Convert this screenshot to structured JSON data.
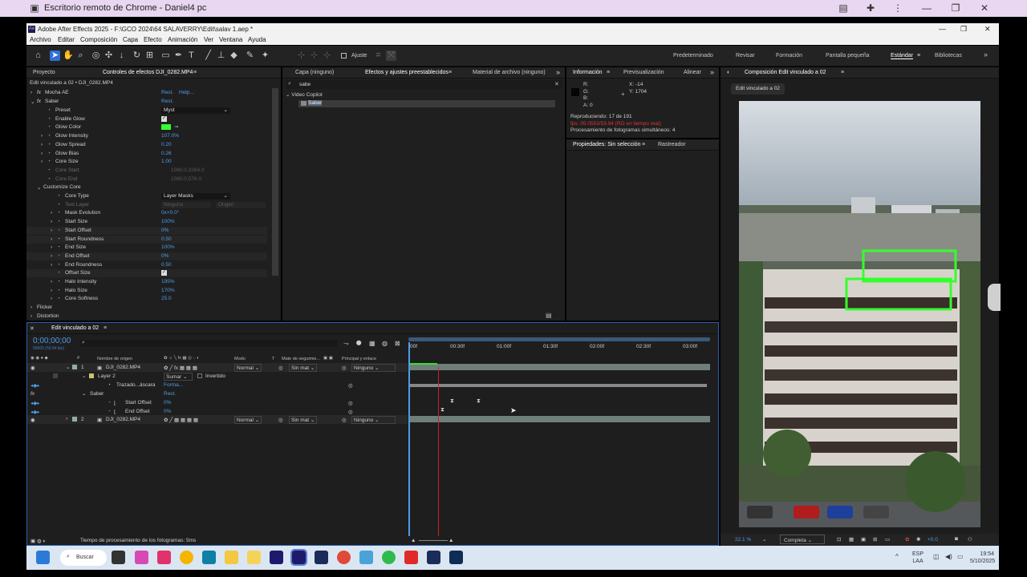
{
  "remote": {
    "title": "Escritorio remoto de Chrome - Daniel4 pc"
  },
  "app": {
    "title": "Adobe After Effects 2025 - F:\\GCO 2024\\64 SALAVERRY\\Edit\\salav 1.aep *",
    "menu": [
      "Archivo",
      "Editar",
      "Composición",
      "Capa",
      "Efecto",
      "Animación",
      "Ver",
      "Ventana",
      "Ayuda"
    ]
  },
  "toolbar": {
    "snap_label": "Ajuste",
    "workspaces": [
      "Predeterminado",
      "Revisar",
      "Formación",
      "Pantalla pequeña",
      "Estándar",
      "Bibliotecas"
    ]
  },
  "project_panel": {
    "tab_project": "Proyecto",
    "tab_effects": "Controles de efectos DJI_0282.MP4"
  },
  "effect_controls": {
    "header": "Edit vinculado a 02 • DJI_0282.MP4",
    "mocha": {
      "label": "Mocha AE",
      "reset": "Rest.",
      "help": "Help..."
    },
    "saber": {
      "label": "Saber",
      "reset": "Rest."
    },
    "props": [
      {
        "name": "Preset",
        "value": "Myst",
        "kind": "dropdown"
      },
      {
        "name": "Enable Glow",
        "value": "",
        "kind": "check"
      },
      {
        "name": "Glow Color",
        "value": "",
        "kind": "color"
      },
      {
        "name": "Glow Intensity",
        "value": "107.0%"
      },
      {
        "name": "Glow Spread",
        "value": "0.20"
      },
      {
        "name": "Glow Bias",
        "value": "0.26"
      },
      {
        "name": "Core Size",
        "value": "1.00"
      },
      {
        "name": "Core Start",
        "value": "1080.0,3264.0",
        "dim": true
      },
      {
        "name": "Core End",
        "value": "1080.0,576.0",
        "dim": true
      },
      {
        "name": "Customize Core",
        "value": "",
        "group": true
      },
      {
        "name": "Core Type",
        "value": "Layer Masks",
        "kind": "dropdown"
      },
      {
        "name": "Text Layer",
        "value": "Ninguno",
        "value2": "Origen",
        "dim": true,
        "kind": "dropdown2"
      },
      {
        "name": "Mask Evolution",
        "value": "0x+0.0°"
      },
      {
        "name": "Start Size",
        "value": "100%"
      },
      {
        "name": "Start Offset",
        "value": "0%"
      },
      {
        "name": "Start Roundness",
        "value": "0.50"
      },
      {
        "name": "End Size",
        "value": "100%"
      },
      {
        "name": "End Offset",
        "value": "0%"
      },
      {
        "name": "End Roundness",
        "value": "0.50"
      },
      {
        "name": "Offset Size",
        "value": "",
        "kind": "check"
      },
      {
        "name": "Halo Intensity",
        "value": "195%"
      },
      {
        "name": "Halo Size",
        "value": "170%"
      },
      {
        "name": "Core Softness",
        "value": "25.0"
      },
      {
        "name": "Flicker",
        "value": "",
        "top": true
      },
      {
        "name": "Distortion",
        "value": "",
        "top": true
      }
    ]
  },
  "effects_panel": {
    "tab_layer": "Capa (ninguno)",
    "tab_effects": "Efectos y ajustes preestablecidos",
    "tab_footage": "Material de archivo (ninguno)",
    "search": "sabe",
    "folder": "Video Copilot",
    "item": "Saber"
  },
  "info_panel": {
    "tab_info": "Información",
    "tab_preview": "Previsualización",
    "tab_align": "Alinear",
    "r": "R:",
    "g": "G:",
    "b": "B:",
    "a": "A:  0",
    "x": "X:  -14",
    "y": "Y:  1704",
    "playing": "Reproduciendo: 17 de 191",
    "fps": "fps: 05.0553/59.94 (RO en tiempo real)",
    "frames": "Procesamiento de fotogramas simultáneos: 4"
  },
  "props_panel": {
    "tab_props": "Propiedades: Sin selección",
    "tab_tracker": "Rastreador"
  },
  "comp_panel": {
    "tab": "Composición Edit vinculado a 02",
    "subtab": "Edit vinculado a 02",
    "zoom": "22.1 %",
    "resolution": "Completa",
    "exposure": "+0.0"
  },
  "timeline": {
    "tab": "Edit vinculado a 02",
    "timecode": "0;00;00;00",
    "timecode_sub": "00000 (59.94 fps)",
    "col_source": "Nombre de origen",
    "col_mode": "Modo",
    "col_t": "T",
    "col_track": "Mate de seguimie...",
    "col_parent": "Principal y enlace",
    "ruler": [
      "00f",
      "00:30f",
      "01:00f",
      "01:30f",
      "02:00f",
      "02:30f",
      "03:00f"
    ],
    "layer1": {
      "num": "1",
      "name": "DJI_0282.MP4",
      "mode": "Normal",
      "track": "Sin mat",
      "parent": "Ninguno"
    },
    "layer2_mask": "Layer 2",
    "mask_mode": "Sumar",
    "mask_inverted": "Invertido",
    "path": "Trazado...áscara",
    "path_val": "Forma...",
    "saber": "Saber",
    "saber_reset": "Rest.",
    "start_offset": "Start Offset",
    "start_offset_val": "0%",
    "end_offset": "End Offset",
    "end_offset_val": "0%",
    "layer2": {
      "num": "2",
      "name": "DJI_0282.MP4",
      "mode": "Normal",
      "track": "Sin mat",
      "parent": "Ninguno"
    },
    "status": "Tiempo de procesamiento de los fotogramas: 5ms"
  },
  "taskbar": {
    "search": "Buscar",
    "lang1": "ESP",
    "lang2": "LAA",
    "time": "19:54",
    "date": "5/10/2025"
  }
}
